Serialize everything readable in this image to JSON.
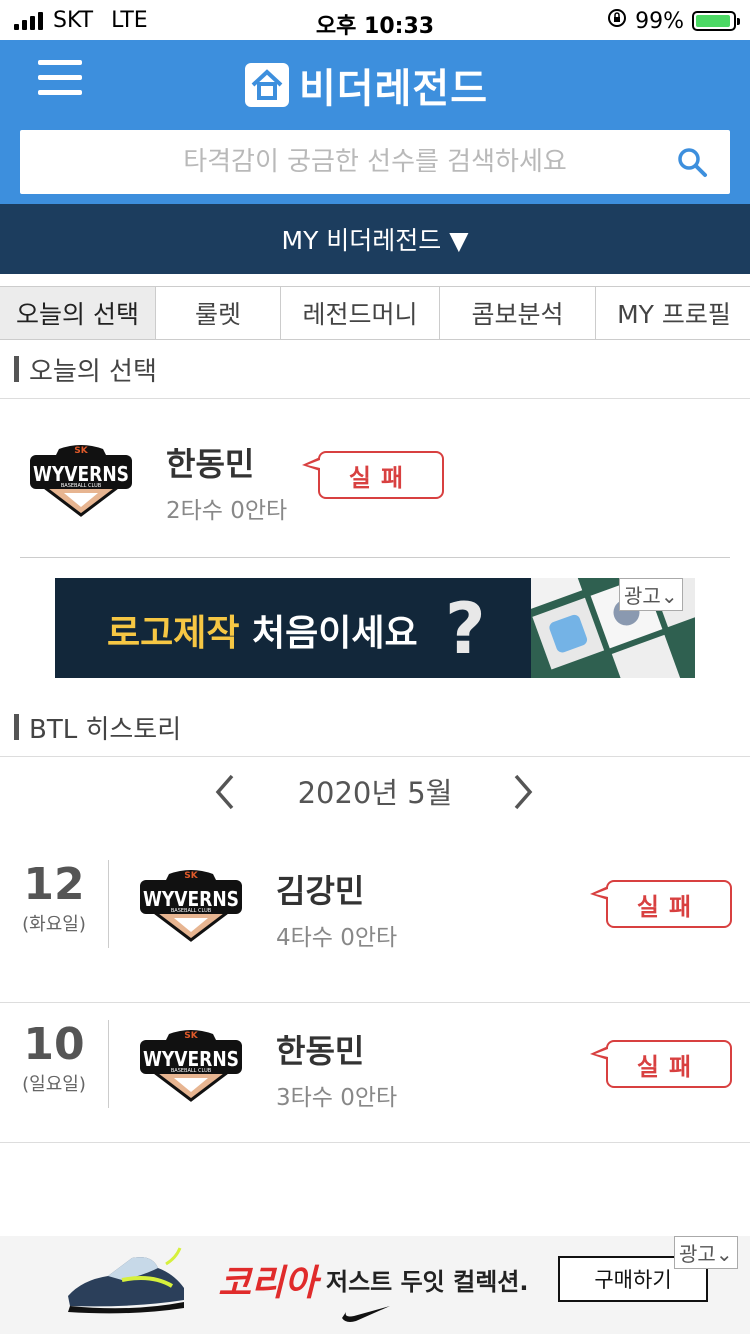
{
  "status": {
    "carrier": "SKT",
    "network": "LTE",
    "time": "오후 10:33",
    "battery": "99%"
  },
  "header": {
    "app_title": "비더레전드",
    "search_placeholder": "타격감이 궁금한 선수를 검색하세요"
  },
  "mybar": {
    "label": "MY 비더레전드 ▼"
  },
  "tabs": [
    {
      "label": "오늘의 선택",
      "active": true
    },
    {
      "label": "룰렛"
    },
    {
      "label": "레전드머니"
    },
    {
      "label": "콤보분석"
    },
    {
      "label": "MY 프로필"
    }
  ],
  "today": {
    "section_title": "오늘의 선택",
    "team_logo": {
      "small": "SK",
      "big": "WYVERNS",
      "sub": "BASEBALL CLUB"
    },
    "player": "한동민",
    "stat": "2타수 0안타",
    "result": "실패"
  },
  "ad_banner": {
    "highlight": "로고제작",
    "text": " 처음이세요",
    "mark": "?",
    "badge": "광고"
  },
  "history": {
    "section_title": "BTL 히스토리",
    "month": "2020년 5월",
    "rows": [
      {
        "day": "12",
        "dow": "(화요일)",
        "player": "김강민",
        "stat": "4타수 0안타",
        "result": "실패"
      },
      {
        "day": "10",
        "dow": "(일요일)",
        "player": "한동민",
        "stat": "3타수 0안타",
        "result": "실패"
      }
    ]
  },
  "bottom_ad": {
    "brand": "코리아",
    "slogan": "저스트 두잇 컬렉션.",
    "button": "구매하기",
    "badge": "광고"
  },
  "colors": {
    "header_blue": "#3d8fdd",
    "navy": "#1c3d5e",
    "fail_red": "#d84040"
  }
}
